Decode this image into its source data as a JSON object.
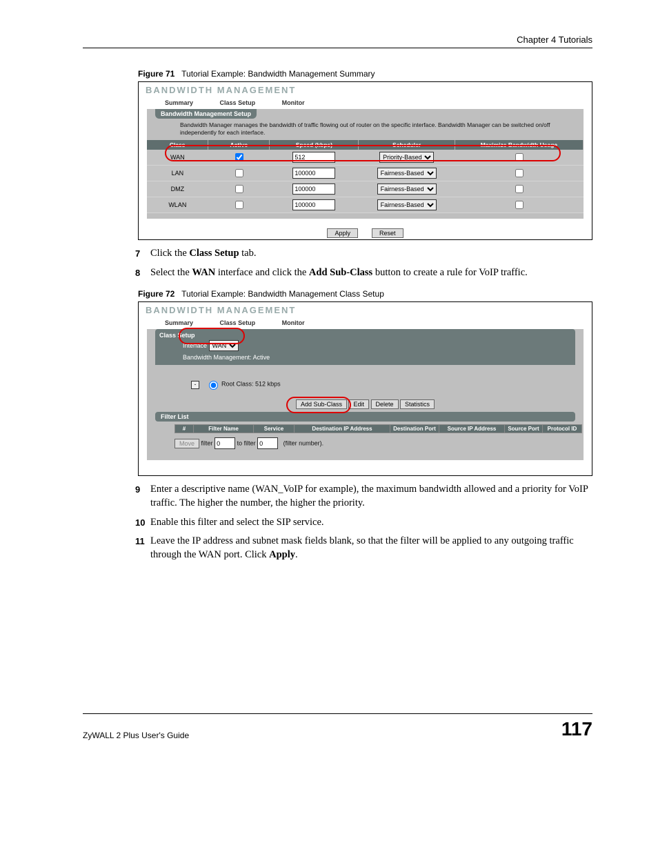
{
  "chapter": "Chapter 4 Tutorials",
  "fig71": {
    "label": "Figure 71",
    "caption": "Tutorial Example: Bandwidth Management Summary",
    "title": "BANDWIDTH MANAGEMENT",
    "tabs": [
      "Summary",
      "Class Setup",
      "Monitor"
    ],
    "section": "Bandwidth Management Setup",
    "desc": "Bandwidth Manager manages the bandwidth of traffic flowing out of router on the specific interface. Bandwidth Manager can be switched on/off independently for each interface.",
    "headers": [
      "Class",
      "Active",
      "Speed (kbps)",
      "Scheduler",
      "Maximize Bandwidth Usage"
    ],
    "rows": [
      {
        "class": "WAN",
        "active": true,
        "speed": "512",
        "scheduler": "Priority-Based",
        "max": false,
        "highlight": true
      },
      {
        "class": "LAN",
        "active": false,
        "speed": "100000",
        "scheduler": "Fairness-Based",
        "max": false,
        "highlight": false
      },
      {
        "class": "DMZ",
        "active": false,
        "speed": "100000",
        "scheduler": "Fairness-Based",
        "max": false,
        "highlight": false
      },
      {
        "class": "WLAN",
        "active": false,
        "speed": "100000",
        "scheduler": "Fairness-Based",
        "max": false,
        "highlight": false
      }
    ],
    "apply": "Apply",
    "reset": "Reset"
  },
  "step7": {
    "num": "7",
    "t1": "Click the ",
    "b1": "Class Setup",
    "t2": " tab."
  },
  "step8": {
    "num": "8",
    "t1": "Select the ",
    "b1": "WAN",
    "t2": " interface and click the ",
    "b2": "Add Sub-Class",
    "t3": " button to create a rule for VoIP traffic."
  },
  "fig72": {
    "label": "Figure 72",
    "caption": "Tutorial Example: Bandwidth Management Class Setup",
    "title": "BANDWIDTH MANAGEMENT",
    "tabs": [
      "Summary",
      "Class Setup",
      "Monitor"
    ],
    "section": "Class Setup",
    "iface_label": "Interface",
    "iface_value": "WAN",
    "bm_status": "Bandwidth Management: Active",
    "root": "Root Class: 512 kbps",
    "btns": {
      "add": "Add Sub-Class",
      "edit": "Edit",
      "del": "Delete",
      "stats": "Statistics"
    },
    "filter_section": "Filter List",
    "filter_headers": [
      "#",
      "Filter Name",
      "Service",
      "Destination IP Address",
      "Destination Port",
      "Source IP Address",
      "Source Port",
      "Protocol ID"
    ],
    "move": "Move",
    "filter_word": "filter",
    "to_filter": "to filter",
    "filter_number": "(filter number).",
    "f1": "0",
    "f2": "0"
  },
  "step9": {
    "num": "9",
    "text": "Enter a descriptive name (WAN_VoIP for example), the maximum bandwidth allowed and a priority for VoIP traffic. The higher the number, the higher the priority."
  },
  "step10": {
    "num": "10",
    "text": "Enable this filter and select the SIP service."
  },
  "step11": {
    "num": "11",
    "t1": "Leave the IP address and subnet mask fields blank, so that the filter will be applied to any outgoing traffic through the WAN port. Click ",
    "b1": "Apply",
    "t2": "."
  },
  "footer": {
    "guide": "ZyWALL 2 Plus User's Guide",
    "page": "117"
  }
}
